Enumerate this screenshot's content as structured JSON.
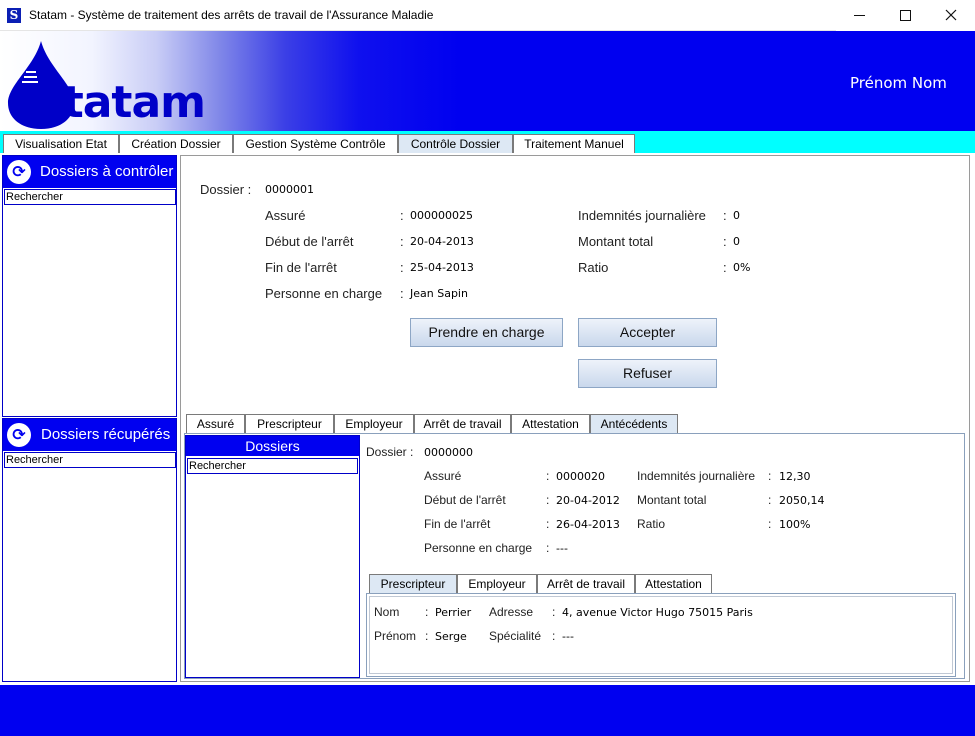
{
  "window": {
    "icon_letter": "S",
    "title": "Statam - Système de traitement des arrêts de travail de l'Assurance Maladie",
    "minimize": "—",
    "maximize": "☐",
    "close": "✕"
  },
  "banner": {
    "logo": "Statam",
    "user_name": "Prénom Nom"
  },
  "main_tabs": [
    "Visualisation Etat",
    "Création Dossier",
    "Gestion Système Contrôle",
    "Contrôle Dossier",
    "Traitement Manuel"
  ],
  "left_panels": {
    "to_control": {
      "title": "Dossiers à contrôler",
      "search": "Rechercher"
    },
    "recovered": {
      "title": "Dossiers récupérés",
      "search": "Rechercher"
    }
  },
  "dossier": {
    "label": "Dossier :",
    "number": "0000001",
    "fields_left": [
      {
        "label": "Assuré",
        "value": "000000025"
      },
      {
        "label": "Début de l'arrêt",
        "value": "20-04-2013"
      },
      {
        "label": "Fin de l'arrêt",
        "value": "25-04-2013"
      },
      {
        "label": "Personne en charge",
        "value": "Jean Sapin"
      }
    ],
    "fields_right": [
      {
        "label": "Indemnités journalière",
        "value": "0"
      },
      {
        "label": "Montant total",
        "value": "0"
      },
      {
        "label": "Ratio",
        "value": "0%"
      }
    ]
  },
  "actions": {
    "take_charge": "Prendre en charge",
    "accept": "Accepter",
    "refuse": "Refuser"
  },
  "detail_tabs": [
    "Assuré",
    "Prescripteur",
    "Employeur",
    "Arrêt de travail",
    "Attestation",
    "Antécédents"
  ],
  "history": {
    "list_title": "Dossiers",
    "search": "Rechercher",
    "dossier_label": "Dossier :",
    "dossier_number": "0000000",
    "fields_left": [
      {
        "label": "Assuré",
        "value": "0000020"
      },
      {
        "label": "Début de l'arrêt",
        "value": "20-04-2012"
      },
      {
        "label": "Fin de l'arrêt",
        "value": "26-04-2013"
      },
      {
        "label": "Personne en charge",
        "value": "---"
      }
    ],
    "fields_right": [
      {
        "label": "Indemnités journalière",
        "value": "12,30"
      },
      {
        "label": "Montant total",
        "value": "2050,14"
      },
      {
        "label": "Ratio",
        "value": "100%"
      }
    ],
    "sub_tabs": [
      "Prescripteur",
      "Employeur",
      "Arrêt de travail",
      "Attestation"
    ],
    "prescriber": {
      "nom_label": "Nom",
      "nom": "Perrier",
      "prenom_label": "Prénom",
      "prenom": "Serge",
      "adresse_label": "Adresse",
      "adresse": "4, avenue Victor Hugo 75015 Paris",
      "specialite_label": "Spécialité",
      "specialite": "---"
    }
  }
}
